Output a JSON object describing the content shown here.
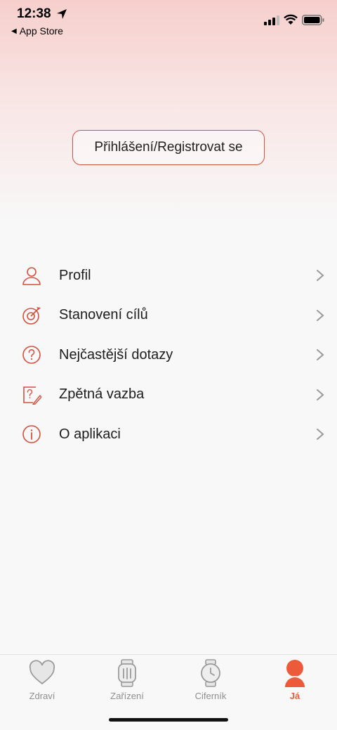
{
  "status_bar": {
    "time": "12:38",
    "back_label": "App Store",
    "icons": [
      "location-arrow-icon",
      "signal-icon",
      "wifi-icon",
      "battery-icon"
    ]
  },
  "login_button": {
    "label": "Přihlášení/Registrovat se"
  },
  "menu": {
    "items": [
      {
        "label": "Profil",
        "icon": "person-icon"
      },
      {
        "label": "Stanovení cílů",
        "icon": "target-icon"
      },
      {
        "label": "Nejčastější dotazy",
        "icon": "question-icon"
      },
      {
        "label": "Zpětná vazba",
        "icon": "feedback-icon"
      },
      {
        "label": "O aplikaci",
        "icon": "info-icon"
      }
    ]
  },
  "tabbar": {
    "tabs": [
      {
        "label": "Zdraví",
        "icon": "heart-icon",
        "active": false
      },
      {
        "label": "Zařízení",
        "icon": "watch-band-icon",
        "active": false
      },
      {
        "label": "Ciferník",
        "icon": "watch-face-icon",
        "active": false
      },
      {
        "label": "Já",
        "icon": "user-icon",
        "active": true
      }
    ]
  },
  "colors": {
    "accent": "#d4503f",
    "active_tab": "#ec5a3a",
    "inactive_tab": "#8e8e8e",
    "gradient_top": "#f6cfcc"
  }
}
